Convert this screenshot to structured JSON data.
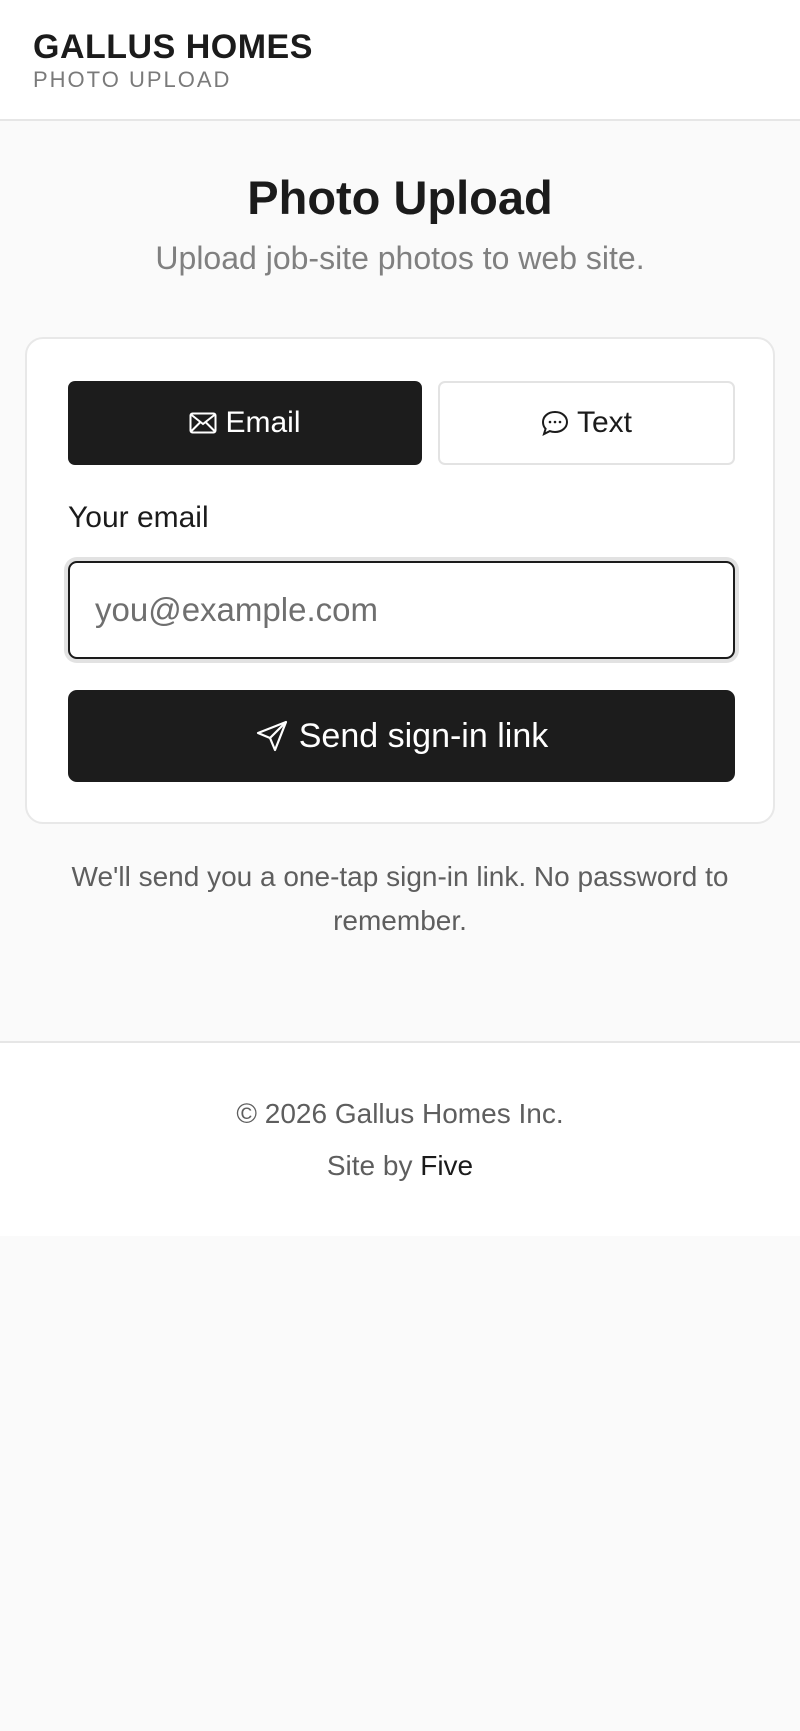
{
  "header": {
    "brand_name": "GALLUS HOMES",
    "brand_subtitle": "PHOTO UPLOAD"
  },
  "main": {
    "title": "Photo Upload",
    "subtitle": "Upload job-site photos to web site."
  },
  "signin_card": {
    "tabs": [
      {
        "label": "Email",
        "icon": "envelope-icon",
        "active": true
      },
      {
        "label": "Text",
        "icon": "speech-bubble-icon",
        "active": false
      }
    ],
    "email_label": "Your email",
    "email_value": "",
    "email_placeholder": "you@example.com",
    "submit_label": "Send sign-in link",
    "submit_icon": "paper-plane-icon"
  },
  "helper_text": "We'll send you a one-tap sign-in link. No password to remember.",
  "footer": {
    "copyright": "© 2026 Gallus Homes Inc.",
    "credit_prefix": "Site by",
    "credit_link": "Five"
  },
  "colors": {
    "page_background": "#fafafa",
    "surface": "#ffffff",
    "primary_dark": "#1c1c1c",
    "text_primary": "#1b1b1b",
    "text_muted": "#808080",
    "border": "#e6e6e6"
  }
}
